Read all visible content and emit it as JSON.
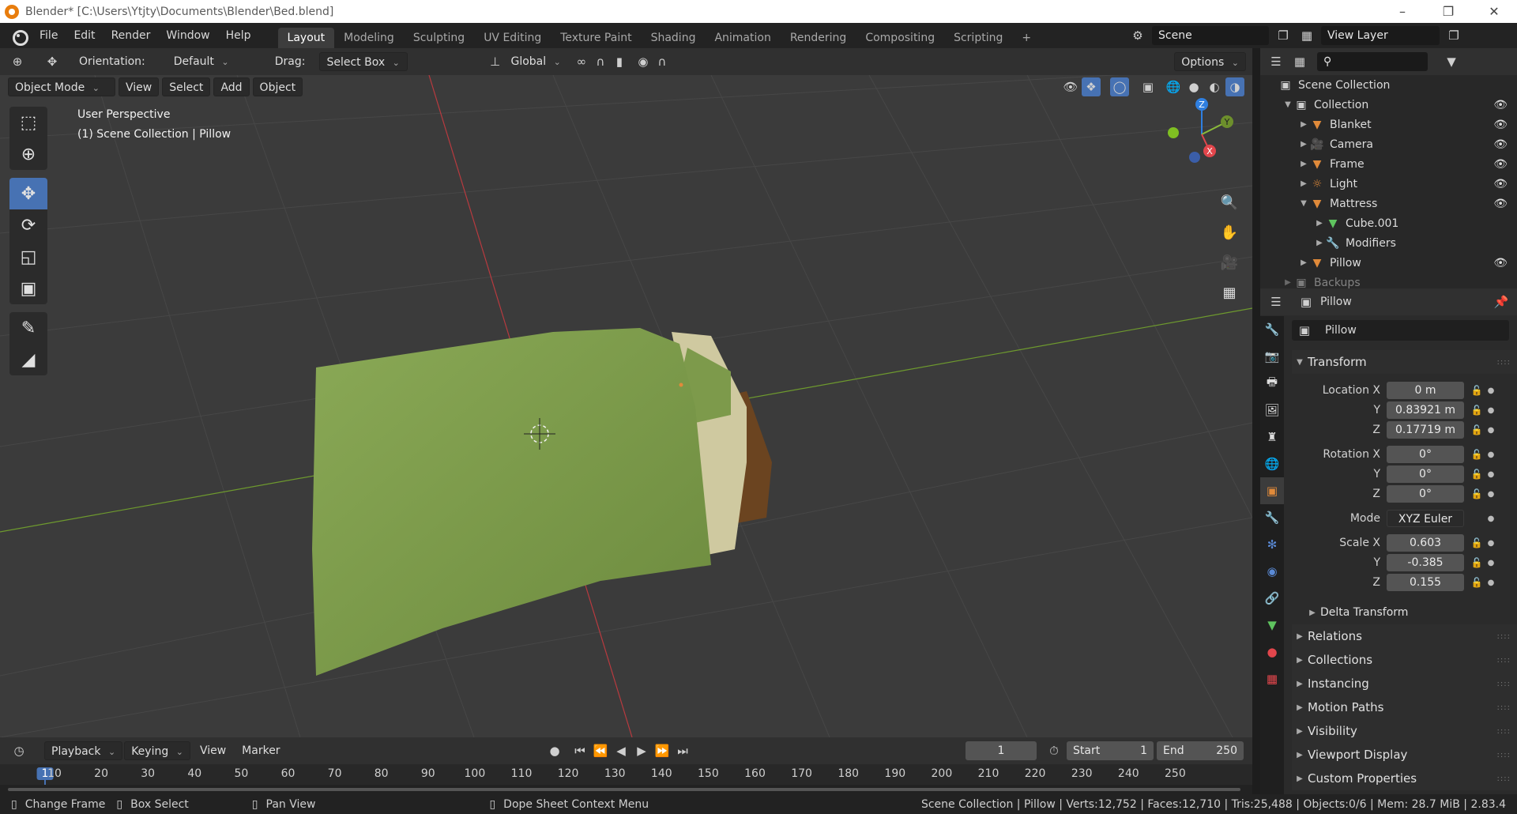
{
  "window": {
    "title": "Blender* [C:\\Users\\Ytjty\\Documents\\Blender\\Bed.blend]"
  },
  "menubar": {
    "menus": [
      "File",
      "Edit",
      "Render",
      "Window",
      "Help"
    ],
    "workspaces": [
      "Layout",
      "Modeling",
      "Sculpting",
      "UV Editing",
      "Texture Paint",
      "Shading",
      "Animation",
      "Rendering",
      "Compositing",
      "Scripting"
    ],
    "active_workspace": "Layout",
    "add_tab": "+",
    "scene": "Scene",
    "view_layer": "View Layer"
  },
  "viewport_header": {
    "orientation_label": "Orientation:",
    "orientation_value": "Default",
    "drag_label": "Drag:",
    "drag_value": "Select Box",
    "transform_orientation": "Global",
    "options": "Options"
  },
  "viewport_header2": {
    "mode": "Object Mode",
    "menus": [
      "View",
      "Select",
      "Add",
      "Object"
    ]
  },
  "viewport": {
    "perspective": "User Perspective",
    "context": "(1) Scene Collection | Pillow",
    "gizmo_axes": [
      "Z",
      "Y",
      "X"
    ]
  },
  "toolbar": {
    "tools": [
      "select-box",
      "cursor",
      "move",
      "rotate",
      "scale",
      "transform",
      "annotate",
      "measure"
    ],
    "active": "move"
  },
  "timeline": {
    "menus": [
      "Playback",
      "Keying",
      "View",
      "Marker"
    ],
    "current_frame": "1",
    "start_label": "Start",
    "start": "1",
    "end_label": "End",
    "end": "250",
    "ticks": [
      "1",
      "10",
      "20",
      "30",
      "40",
      "50",
      "60",
      "70",
      "80",
      "90",
      "100",
      "110",
      "120",
      "130",
      "140",
      "150",
      "160",
      "170",
      "180",
      "190",
      "200",
      "210",
      "220",
      "230",
      "240",
      "250"
    ]
  },
  "statusbar": {
    "left": [
      "Change Frame",
      "Box Select",
      "Pan View",
      "Dope Sheet Context Menu"
    ],
    "right": "Scene Collection | Pillow | Verts:12,752 | Faces:12,710 | Tris:25,488 | Objects:0/6 | Mem: 28.7 MiB | 2.83.4"
  },
  "outliner": {
    "rows": [
      {
        "label": "Scene Collection",
        "icon": "scene-collection-icon",
        "depth": 0
      },
      {
        "label": "Collection",
        "icon": "collection-icon",
        "depth": 1
      },
      {
        "label": "Blanket",
        "icon": "mesh-object-icon",
        "depth": 2
      },
      {
        "label": "Camera",
        "icon": "camera-object-icon",
        "depth": 2
      },
      {
        "label": "Frame",
        "icon": "mesh-object-icon",
        "depth": 2
      },
      {
        "label": "Light",
        "icon": "light-object-icon",
        "depth": 2
      },
      {
        "label": "Mattress",
        "icon": "mesh-object-icon",
        "depth": 2
      },
      {
        "label": "Cube.001",
        "icon": "mesh-data-icon",
        "depth": 3
      },
      {
        "label": "Modifiers",
        "icon": "wrench-icon",
        "depth": 3
      },
      {
        "label": "Pillow",
        "icon": "mesh-object-icon",
        "depth": 2
      },
      {
        "label": "Backups",
        "icon": "collection-icon",
        "depth": 1
      }
    ]
  },
  "properties": {
    "header_object": "Pillow",
    "name_field": "Pillow",
    "transform": {
      "title": "Transform",
      "location_label": "Location X",
      "location": [
        "0 m",
        "0.83921 m",
        "0.17719 m"
      ],
      "rotation_label": "Rotation X",
      "rotation": [
        "0°",
        "0°",
        "0°"
      ],
      "mode_label": "Mode",
      "mode": "XYZ Euler",
      "scale_label": "Scale X",
      "scale": [
        "0.603",
        "-0.385",
        "0.155"
      ],
      "axis_y": "Y",
      "axis_z": "Z"
    },
    "sections": [
      "Delta Transform",
      "Relations",
      "Collections",
      "Instancing",
      "Motion Paths",
      "Visibility",
      "Viewport Display",
      "Custom Properties"
    ]
  },
  "colors": {
    "accent": "#4772b3",
    "blanket": "#7b9a4a",
    "pillow": "#cfc9a0",
    "frame": "#6b4420",
    "axis_x": "#e2464c",
    "axis_y": "#8bbb3a",
    "axis_z": "#2f7fe0",
    "object_orange": "#e08a3a"
  }
}
